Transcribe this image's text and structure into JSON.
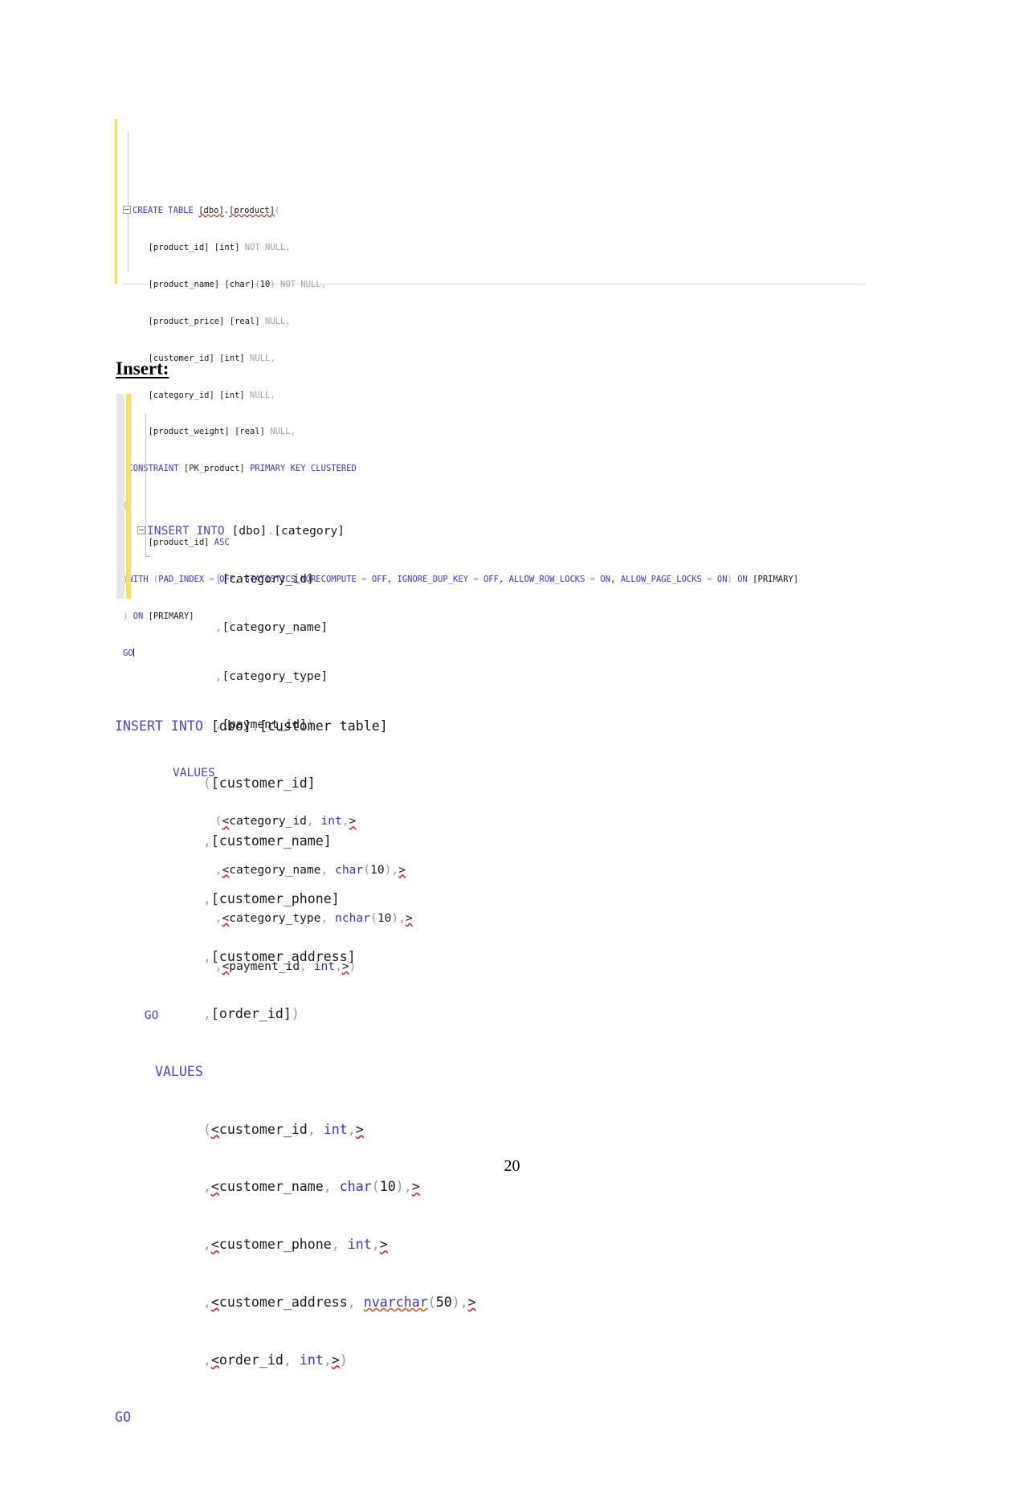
{
  "document": {
    "page_number": "20",
    "heading_insert": "Insert:"
  },
  "code_block_create_table": {
    "title": "CREATE TABLE product",
    "lines": [
      "CREATE TABLE [dbo].[product](",
      "    [product_id] [int] NOT NULL,",
      "    [product_name] [char](10) NOT NULL,",
      "    [product_price] [real] NULL,",
      "    [customer_id] [int] NULL,",
      "    [category_id] [int] NULL,",
      "    [product_weight] [real] NULL,",
      " CONSTRAINT [PK_product] PRIMARY KEY CLUSTERED",
      "(",
      "    [product_id] ASC",
      ")WITH (PAD_INDEX = OFF, STATISTICS_NORECOMPUTE = OFF, IGNORE_DUP_KEY = OFF, ALLOW_ROW_LOCKS = ON, ALLOW_PAGE_LOCKS = ON) ON [PRIMARY]",
      ") ON [PRIMARY]",
      "GO"
    ]
  },
  "code_block_insert_category": {
    "title": "INSERT INTO category",
    "lines": [
      "INSERT INTO [dbo].[category]",
      "           ([category_id]",
      "           ,[category_name]",
      "           ,[category_type]",
      "           ,[payment_id])",
      "     VALUES",
      "           (<category_id, int,>",
      "           ,<category_name, char(10),>",
      "           ,<category_type, nchar(10),>",
      "           ,<payment_id, int,>)",
      "GO"
    ]
  },
  "code_block_insert_customer": {
    "title": "INSERT INTO customer table",
    "lines": [
      "INSERT INTO [dbo].[customer table]",
      "           ([customer_id]",
      "           ,[customer_name]",
      "           ,[customer_phone]",
      "           ,[customer_address]",
      "           ,[order_id])",
      "     VALUES",
      "           (<customer_id, int,>",
      "           ,<customer_name, char(10),>",
      "           ,<customer_phone, int,>",
      "           ,<customer_address, nvarchar(50),>",
      "           ,<order_id, int,>)",
      "GO"
    ]
  },
  "colors": {
    "keyword_blue": "#3a35c8",
    "gray_text": "#a0a0a0",
    "change_bar_yellow": "#f2e05a",
    "gutter_gray": "#e6e6e6",
    "squiggle_red": "#d02020",
    "squiggle_orange": "#d85a12"
  }
}
